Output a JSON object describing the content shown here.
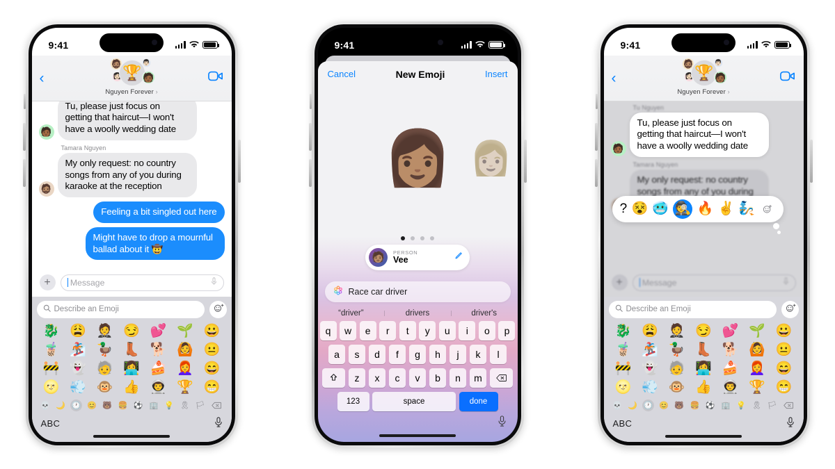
{
  "status_bar": {
    "time": "9:41",
    "signal_icon": "cellular-bars-icon",
    "wifi_icon": "wifi-icon",
    "battery_icon": "battery-icon"
  },
  "phone1": {
    "label": "messages-conversation-with-emoji-keyboard",
    "header": {
      "back_icon": "chevron-left-icon",
      "video_icon": "facetime-video-icon",
      "group_name": "Nguyen Forever",
      "chevron": "›",
      "avatars": [
        "🏆",
        "🧔🏽",
        "👩🏻",
        "👨🏻",
        "🧑🏾"
      ]
    },
    "messages": [
      {
        "type": "incoming",
        "sender": "",
        "avatar": "🧑🏾",
        "text": "Tu, please just focus on getting that haircut—I won't have a woolly wedding date",
        "clipped": true
      },
      {
        "type": "incoming",
        "sender": "Tamara Nguyen",
        "avatar": "🧔🏽",
        "text": "My only request: no country songs from any of you during karaoke at the reception"
      },
      {
        "type": "outgoing",
        "sender": "",
        "avatar": "",
        "text": "Feeling a bit singled out here"
      },
      {
        "type": "outgoing",
        "sender": "",
        "avatar": "",
        "text": "Might have to drop a mournful ballad about it 🤠"
      }
    ],
    "composer": {
      "plus_label": "+",
      "placeholder": "Message",
      "mic_icon": "microphone-icon"
    },
    "emoji_keyboard": {
      "search_placeholder": "Describe an Emoji",
      "search_icon": "search-icon",
      "genmoji_icon": "genmoji-sparkle-icon",
      "grid": [
        "🐉",
        "😩",
        "🤵",
        "😏",
        "💕",
        "🌱",
        "😀",
        "🧋",
        "🏂",
        "🦆",
        "👢",
        "🐕",
        "🙆",
        "😐",
        "🚧",
        "👻",
        "🧓",
        "👩‍💻",
        "🍰",
        "👩‍🦰",
        "😄",
        "🌝",
        "💨",
        "🐵",
        "👍",
        "👨‍🚀",
        "🏆",
        "😁"
      ],
      "categories": [
        "💀",
        "🌙",
        "🕐",
        "😊",
        "🐻",
        "🍔",
        "⚽",
        "🏢",
        "💡",
        "🎗",
        "🏳"
      ],
      "active_category_index": 2,
      "delete_icon": "delete-backspace-icon",
      "abc_label": "ABC",
      "mic_icon": "microphone-icon"
    }
  },
  "phone2": {
    "label": "new-emoji-genmoji-sheet",
    "nav": {
      "cancel": "Cancel",
      "title": "New Emoji",
      "insert": "Insert"
    },
    "memoji": {
      "main": "👩🏽",
      "preview": "👩🏼"
    },
    "page_dots": {
      "count": 4,
      "active_index": 0
    },
    "person_card": {
      "label": "PERSON",
      "name": "Vee",
      "edit_icon": "pencil-edit-icon",
      "avatar_icon": "person-avatar"
    },
    "prompt": {
      "icon": "genmoji-flower-icon",
      "text": "Race car driver"
    },
    "suggestions": [
      "“driver”",
      "drivers",
      "driver's"
    ],
    "keyboard": {
      "row1": [
        "q",
        "w",
        "e",
        "r",
        "t",
        "y",
        "u",
        "i",
        "o",
        "p"
      ],
      "row2": [
        "a",
        "s",
        "d",
        "f",
        "g",
        "h",
        "j",
        "k",
        "l"
      ],
      "row3": [
        "z",
        "x",
        "c",
        "v",
        "b",
        "n",
        "m"
      ],
      "shift_icon": "shift-arrow-icon",
      "delete_icon": "delete-backspace-icon",
      "numbers_label": "123",
      "space_label": "space",
      "done_label": "done",
      "mic_icon": "microphone-icon"
    }
  },
  "phone3": {
    "label": "messages-with-tapback-reaction-picker",
    "header": {
      "back_icon": "chevron-left-icon",
      "video_icon": "facetime-video-icon",
      "group_name": "Nguyen Forever",
      "chevron": "›",
      "avatars": [
        "🏆",
        "🧔🏽",
        "👩🏻",
        "👨🏻",
        "🧑🏾"
      ]
    },
    "tapback": {
      "reactions": [
        "😵",
        "🥶",
        "🕵️",
        "🔥",
        "✌️",
        "🧞"
      ],
      "selected_index": 2,
      "add_icon": "add-emoji-reaction-icon"
    },
    "messages": [
      {
        "type": "incoming",
        "sender": "Tu Nguyen",
        "avatar": "🧑🏾",
        "text": "Tu, please just focus on getting that haircut—I won't have a woolly wedding date"
      },
      {
        "type": "incoming",
        "sender": "Tamara Nguyen",
        "avatar": "🧔🏽",
        "text": "My only request: no country songs from any of you during karaoke at the reception"
      }
    ],
    "composer": {
      "plus_label": "+",
      "placeholder": "Message",
      "mic_icon": "microphone-icon"
    },
    "emoji_keyboard": {
      "search_placeholder": "Describe an Emoji",
      "search_icon": "search-icon",
      "genmoji_icon": "genmoji-sparkle-icon",
      "grid": [
        "🐉",
        "😩",
        "🤵",
        "😏",
        "💕",
        "🌱",
        "😀",
        "🧋",
        "🏂",
        "🦆",
        "👢",
        "🐕",
        "🙆",
        "😐",
        "🚧",
        "👻",
        "🧓",
        "👩‍💻",
        "🍰",
        "👩‍🦰",
        "😄",
        "🌝",
        "💨",
        "🐵",
        "👍",
        "👨‍🚀",
        "🏆",
        "😁"
      ],
      "categories": [
        "💀",
        "🌙",
        "🕐",
        "😊",
        "🐻",
        "🍔",
        "⚽",
        "🏢",
        "💡",
        "🎗",
        "🏳"
      ],
      "active_category_index": 2,
      "delete_icon": "delete-backspace-icon",
      "abc_label": "ABC",
      "mic_icon": "microphone-icon"
    }
  },
  "colors": {
    "imessage_blue": "#1b8dfd",
    "link_blue": "#0a84ff",
    "bubble_gray": "#e9e9eb",
    "keyboard_bg": "#d7d7dd"
  }
}
